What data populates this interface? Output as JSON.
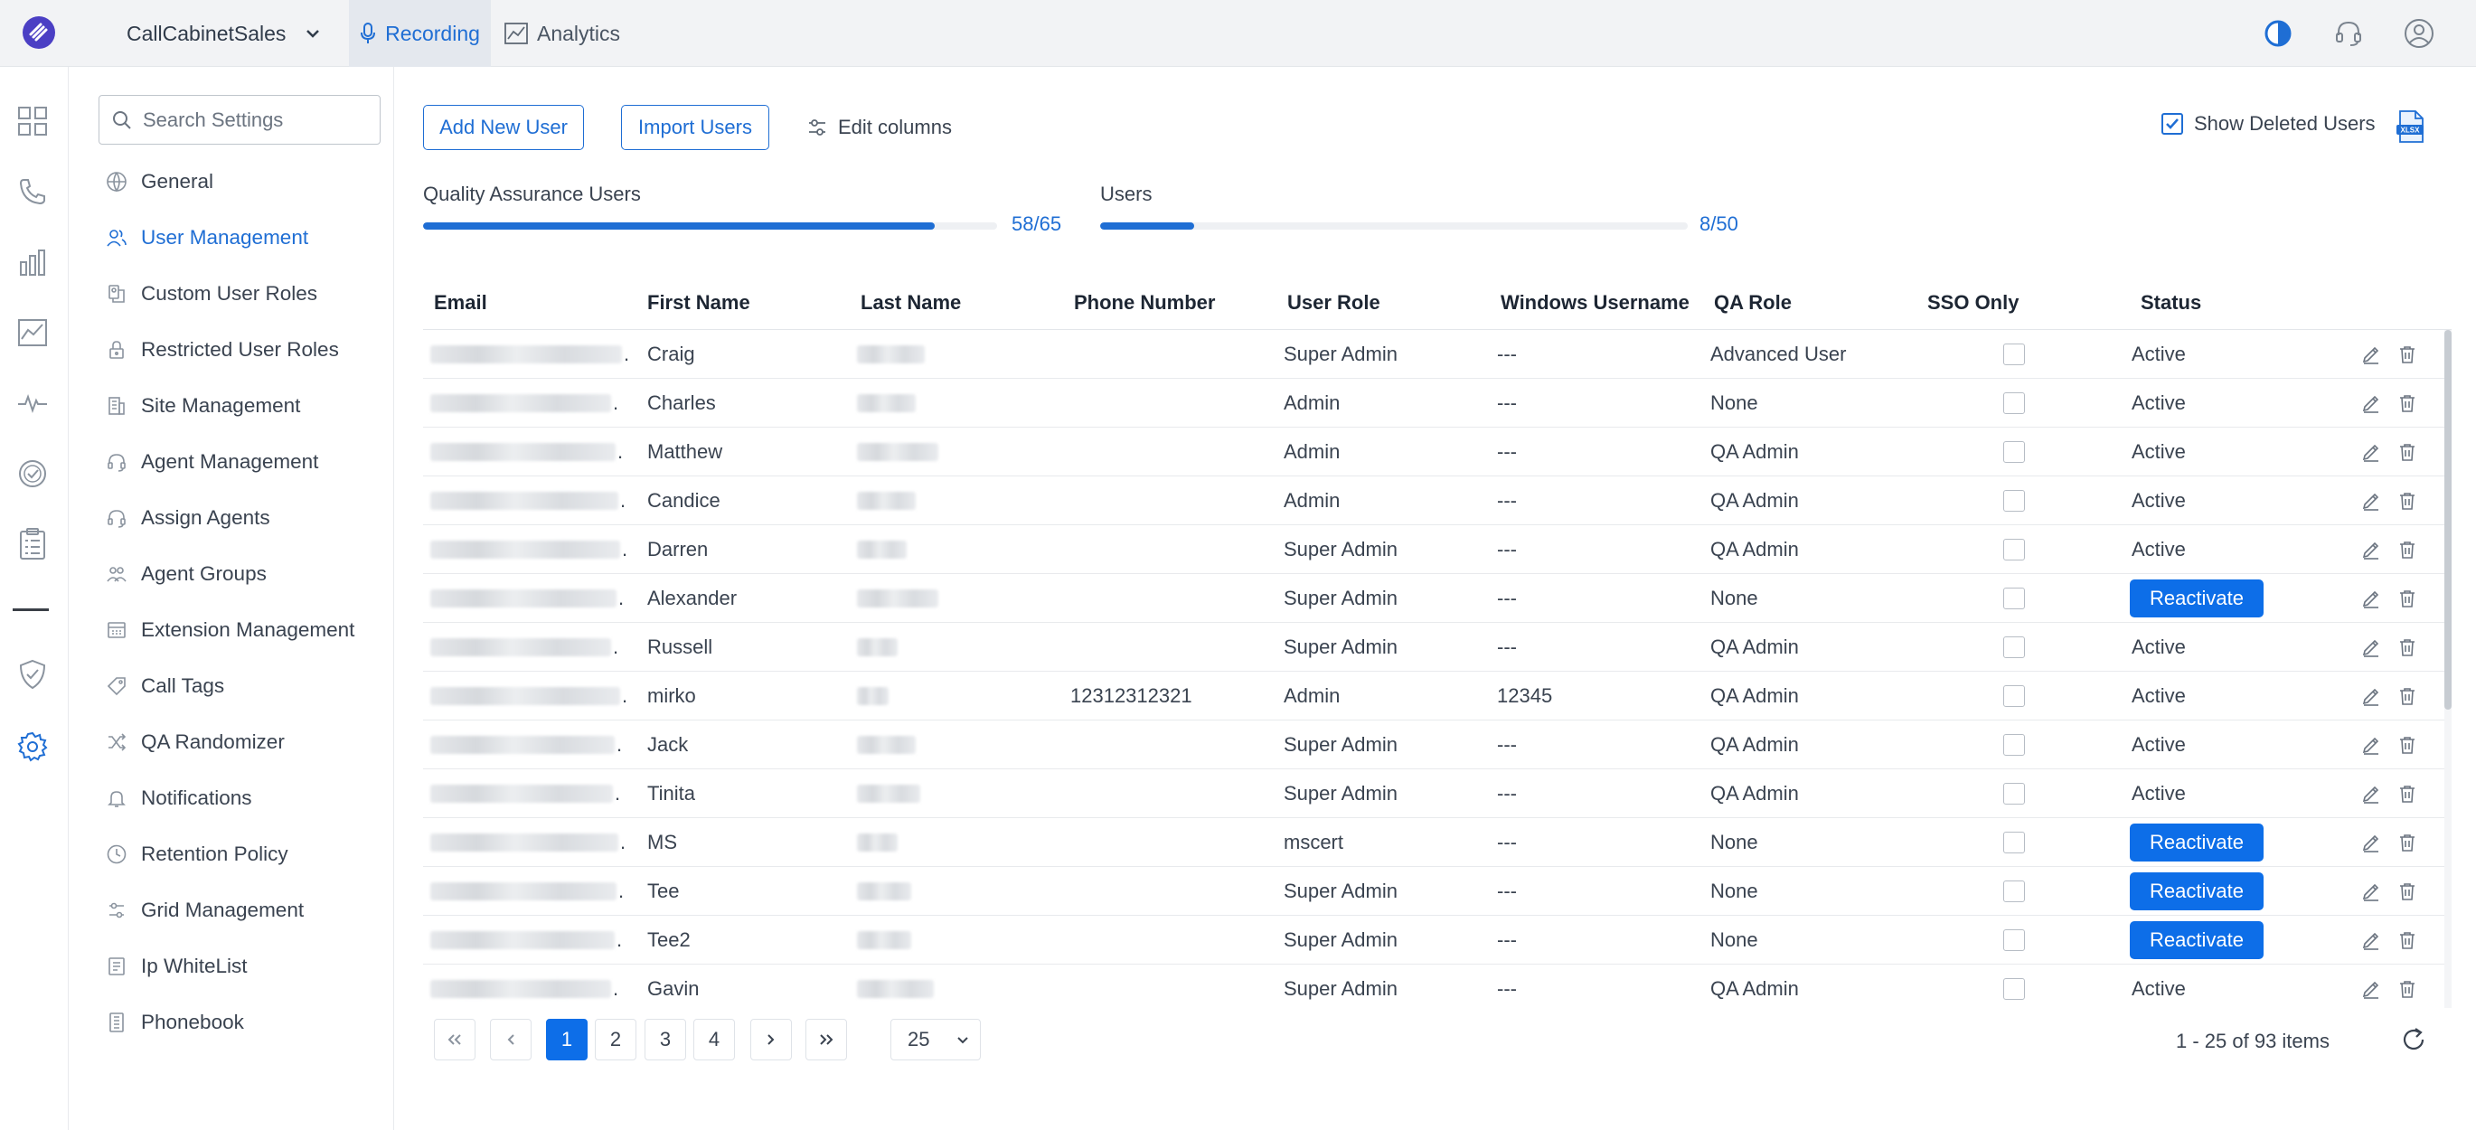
{
  "topbar": {
    "tenant": "CallCabinetSales",
    "tabs": [
      {
        "label": "Recording",
        "icon": "microphone-icon",
        "active": true
      },
      {
        "label": "Analytics",
        "icon": "chart-line-icon",
        "active": false
      }
    ],
    "icons": [
      "contrast-icon",
      "headset-icon",
      "user-account-icon"
    ]
  },
  "rail": {
    "icons": [
      "dashboard-grid-icon",
      "phone-icon",
      "bar-chart-icon",
      "line-chart-icon",
      "pulse-icon",
      "check-circle-icon",
      "clipboard-list-icon",
      "shield-check-icon",
      "settings-gear-icon"
    ],
    "active": "settings-gear-icon"
  },
  "settings": {
    "search_placeholder": "Search Settings",
    "items": [
      {
        "label": "General",
        "icon": "globe-icon"
      },
      {
        "label": "User Management",
        "icon": "users-icon",
        "active": true
      },
      {
        "label": "Custom User Roles",
        "icon": "user-role-icon"
      },
      {
        "label": "Restricted User Roles",
        "icon": "lock-icon"
      },
      {
        "label": "Site Management",
        "icon": "building-icon"
      },
      {
        "label": "Agent Management",
        "icon": "headset-icon"
      },
      {
        "label": "Assign Agents",
        "icon": "headset-icon"
      },
      {
        "label": "Agent Groups",
        "icon": "agent-groups-icon"
      },
      {
        "label": "Extension Management",
        "icon": "extension-icon"
      },
      {
        "label": "Call Tags",
        "icon": "tag-icon"
      },
      {
        "label": "QA Randomizer",
        "icon": "shuffle-icon"
      },
      {
        "label": "Notifications",
        "icon": "bell-icon"
      },
      {
        "label": "Retention Policy",
        "icon": "clock-icon"
      },
      {
        "label": "Grid Management",
        "icon": "sliders-icon"
      },
      {
        "label": "Ip WhiteList",
        "icon": "list-icon"
      },
      {
        "label": "Phonebook",
        "icon": "phonebook-icon"
      }
    ]
  },
  "toolbar": {
    "add_user": "Add New User",
    "import_users": "Import Users",
    "edit_columns": "Edit columns",
    "show_deleted": "Show Deleted Users",
    "show_deleted_checked": true,
    "export_icon": "xlsx-export-icon"
  },
  "quotas": {
    "qa": {
      "label": "Quality Assurance Users",
      "count": "58/65",
      "fraction": 0.892
    },
    "users": {
      "label": "Users",
      "count": "8/50",
      "fraction": 0.16
    }
  },
  "table": {
    "headers": [
      "Email",
      "First Name",
      "Last Name",
      "Phone Number",
      "User Role",
      "Windows Username",
      "QA Role",
      "SSO Only",
      "Status"
    ],
    "reactivate_label": "Reactivate",
    "rows": [
      {
        "first": "Craig",
        "phone": "",
        "role": "Super Admin",
        "win": "---",
        "qa": "Advanced User",
        "status": "Active"
      },
      {
        "first": "Charles",
        "phone": "",
        "role": "Admin",
        "win": "---",
        "qa": "None",
        "status": "Active"
      },
      {
        "first": "Matthew",
        "phone": "",
        "role": "Admin",
        "win": "---",
        "qa": "QA Admin",
        "status": "Active"
      },
      {
        "first": "Candice",
        "phone": "",
        "role": "Admin",
        "win": "---",
        "qa": "QA Admin",
        "status": "Active"
      },
      {
        "first": "Darren",
        "phone": "",
        "role": "Super Admin",
        "win": "---",
        "qa": "QA Admin",
        "status": "Active"
      },
      {
        "first": "Alexander",
        "phone": "",
        "role": "Super Admin",
        "win": "---",
        "qa": "None",
        "status": "Reactivate"
      },
      {
        "first": "Russell",
        "phone": "",
        "role": "Super Admin",
        "win": "---",
        "qa": "QA Admin",
        "status": "Active"
      },
      {
        "first": "mirko",
        "phone": "12312312321",
        "role": "Admin",
        "win": "12345",
        "qa": "QA Admin",
        "status": "Active"
      },
      {
        "first": "Jack",
        "phone": "",
        "role": "Super Admin",
        "win": "---",
        "qa": "QA Admin",
        "status": "Active"
      },
      {
        "first": "Tinita",
        "phone": "",
        "role": "Super Admin",
        "win": "---",
        "qa": "QA Admin",
        "status": "Active"
      },
      {
        "first": "MS",
        "phone": "",
        "role": "mscert",
        "win": "---",
        "qa": "None",
        "status": "Reactivate"
      },
      {
        "first": "Tee",
        "phone": "",
        "role": "Super Admin",
        "win": "---",
        "qa": "None",
        "status": "Reactivate"
      },
      {
        "first": "Tee2",
        "phone": "",
        "role": "Super Admin",
        "win": "---",
        "qa": "None",
        "status": "Reactivate"
      },
      {
        "first": "Gavin",
        "phone": "",
        "role": "Super Admin",
        "win": "---",
        "qa": "QA Admin",
        "status": "Active"
      }
    ]
  },
  "pagination": {
    "pages": [
      "1",
      "2",
      "3",
      "4"
    ],
    "current": "1",
    "page_size": "25",
    "summary": "1 - 25 of 93 items"
  }
}
